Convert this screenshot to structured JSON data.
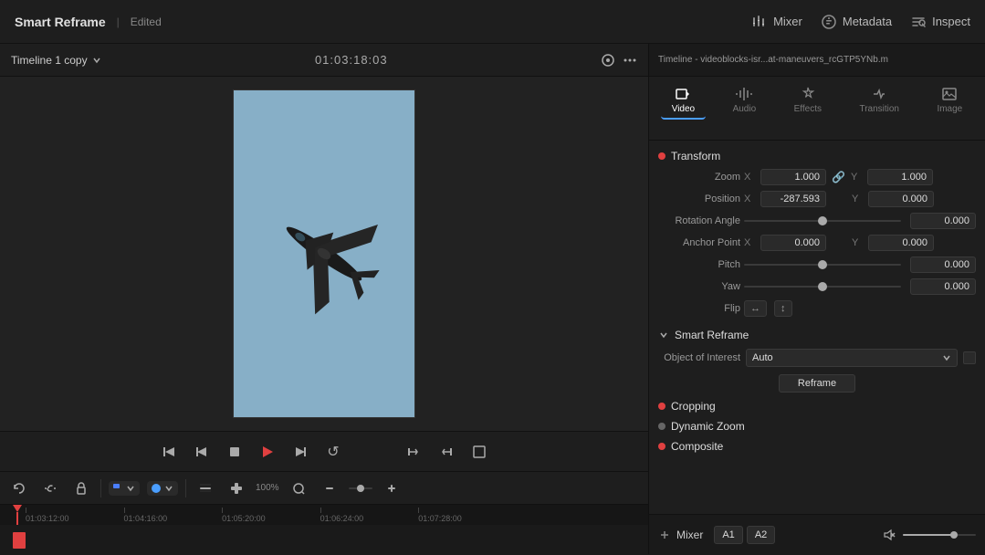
{
  "header": {
    "title": "Smart Reframe",
    "edited_label": "Edited",
    "mixer_label": "Mixer",
    "metadata_label": "Metadata",
    "inspect_label": "Inspect"
  },
  "preview": {
    "timeline_label": "Timeline 1 copy",
    "timecode": "01:03:18:03"
  },
  "playback": {
    "skip_back_label": "⏮",
    "prev_label": "⏪",
    "stop_label": "⏹",
    "play_label": "▶",
    "next_label": "⏭",
    "loop_label": "↺"
  },
  "inspector": {
    "file_label": "Timeline - videoblocks-isr...at-maneuvers_rcGTP5YNb.m",
    "tabs": [
      {
        "id": "video",
        "label": "Video",
        "icon": "🎬",
        "active": true
      },
      {
        "id": "audio",
        "label": "Audio",
        "icon": "🎵",
        "active": false
      },
      {
        "id": "effects",
        "label": "Effects",
        "icon": "✨",
        "active": false
      },
      {
        "id": "transition",
        "label": "Transition",
        "icon": "🔀",
        "active": false
      },
      {
        "id": "image",
        "label": "Image",
        "icon": "🖼",
        "active": false
      }
    ],
    "transform": {
      "title": "Transform",
      "zoom_label": "Zoom",
      "zoom_x": "1.000",
      "zoom_y": "1.000",
      "position_label": "Position",
      "position_x": "-287.593",
      "position_y": "0.000",
      "rotation_label": "Rotation Angle",
      "rotation_value": "0.000",
      "anchor_label": "Anchor Point",
      "anchor_x": "0.000",
      "anchor_y": "0.000",
      "pitch_label": "Pitch",
      "pitch_value": "0.000",
      "yaw_label": "Yaw",
      "yaw_value": "0.000",
      "flip_label": "Flip",
      "flip_h": "↔",
      "flip_v": "↕"
    },
    "smart_reframe": {
      "title": "Smart Reframe",
      "object_label": "Object of Interest",
      "object_value": "Auto",
      "reframe_btn": "Reframe"
    },
    "cropping": {
      "title": "Cropping"
    },
    "dynamic_zoom": {
      "title": "Dynamic Zoom"
    },
    "composite": {
      "title": "Composite"
    }
  },
  "mixer": {
    "label": "Mixer",
    "tracks": [
      "A1",
      "A2"
    ]
  },
  "timeline": {
    "marks": [
      "01:03:12:00",
      "01:04:16:00",
      "01:05:20:00",
      "01:06:24:00",
      "01:07:28:00"
    ]
  }
}
